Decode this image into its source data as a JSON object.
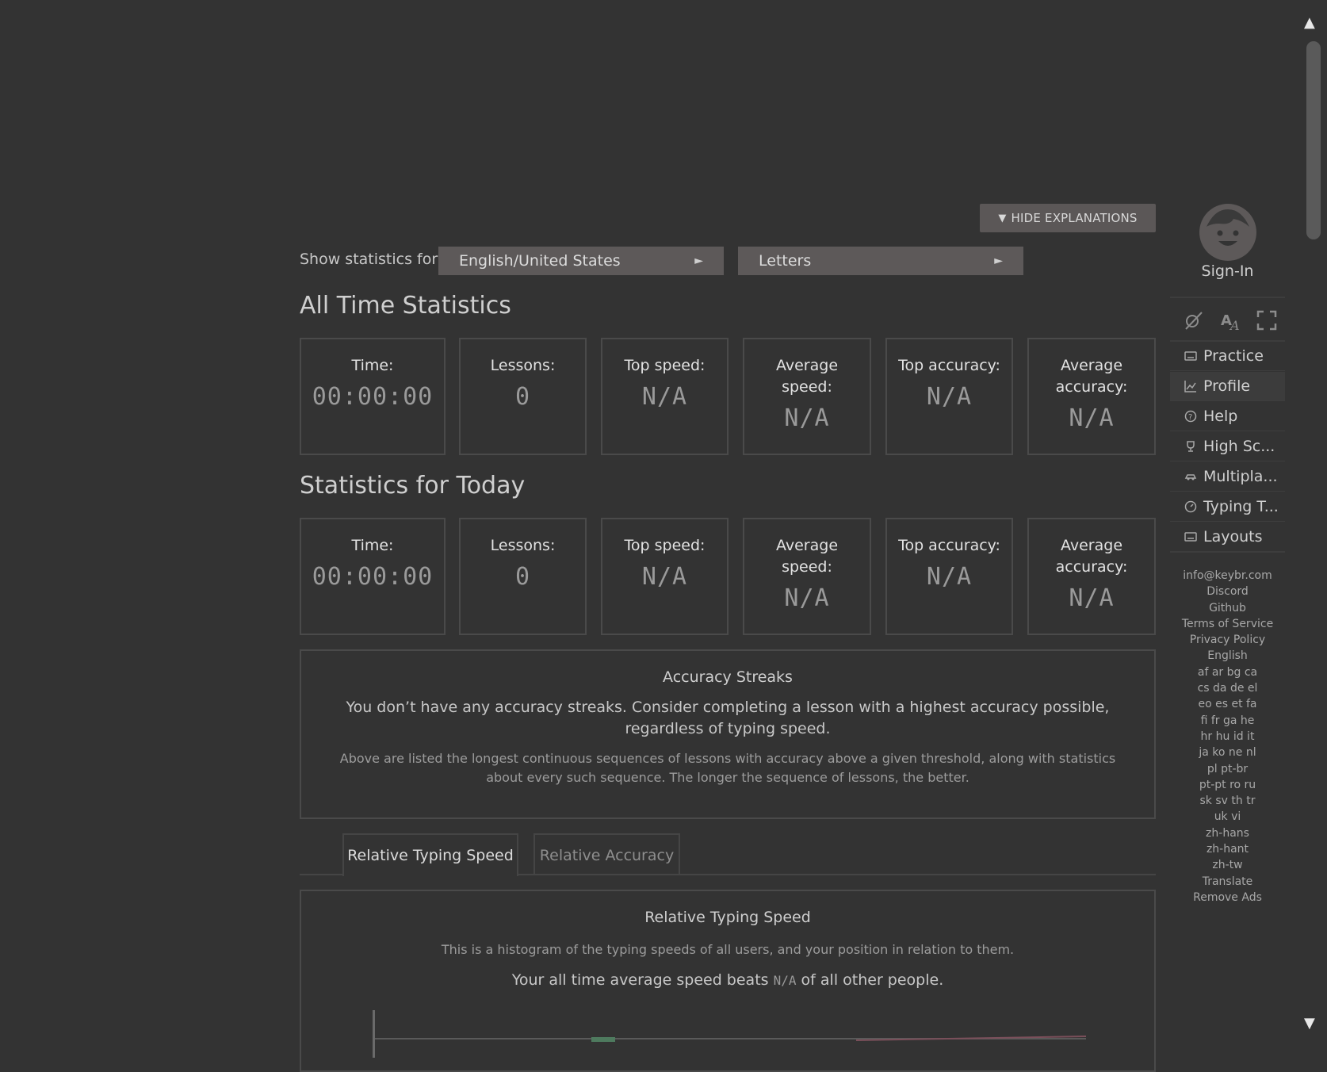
{
  "toolbar": {
    "hide_explanations": "HIDE EXPLANATIONS"
  },
  "filters": {
    "label": "Show statistics for:",
    "layout_value": "English/United States",
    "mode_value": "Letters"
  },
  "all_time": {
    "title": "All Time Statistics",
    "cards": [
      {
        "label": "Time:",
        "value": "00:00:00"
      },
      {
        "label": "Lessons:",
        "value": "0"
      },
      {
        "label": "Top speed:",
        "value": "N/A"
      },
      {
        "label": "Average speed:",
        "value": "N/A"
      },
      {
        "label": "Top accuracy:",
        "value": "N/A"
      },
      {
        "label": "Average accuracy:",
        "value": "N/A"
      }
    ]
  },
  "today": {
    "title": "Statistics for Today",
    "cards": [
      {
        "label": "Time:",
        "value": "00:00:00"
      },
      {
        "label": "Lessons:",
        "value": "0"
      },
      {
        "label": "Top speed:",
        "value": "N/A"
      },
      {
        "label": "Average speed:",
        "value": "N/A"
      },
      {
        "label": "Top accuracy:",
        "value": "N/A"
      },
      {
        "label": "Average accuracy:",
        "value": "N/A"
      }
    ]
  },
  "streaks": {
    "title": "Accuracy Streaks",
    "message": "You don’t have any accuracy streaks. Consider completing a lesson with a highest accuracy possible, regardless of typing speed.",
    "explanation": "Above are listed the longest continuous sequences of lessons with accuracy above a given threshold, along with statistics about every such sequence. The longer the sequence of lessons, the better."
  },
  "tabs": [
    {
      "label": "Relative Typing Speed",
      "active": true
    },
    {
      "label": "Relative Accuracy",
      "active": false
    }
  ],
  "relative_speed": {
    "title": "Relative Typing Speed",
    "description": "This is a histogram of the typing speeds of all users, and your position in relation to them.",
    "beats_prefix": "Your all time average speed beats",
    "beats_value": "N/A",
    "beats_suffix": "of all other people."
  },
  "sidebar": {
    "sign_in": "Sign-In",
    "nav": [
      {
        "label": "Practice",
        "icon": "keyboard-icon"
      },
      {
        "label": "Profile",
        "icon": "chart-icon",
        "active": true
      },
      {
        "label": "Help",
        "icon": "help-icon"
      },
      {
        "label": "High Sc...",
        "icon": "trophy-icon"
      },
      {
        "label": "Multipla...",
        "icon": "car-icon"
      },
      {
        "label": "Typing T...",
        "icon": "speedometer-icon"
      },
      {
        "label": "Layouts",
        "icon": "keyboard-icon"
      }
    ],
    "links": [
      "info@keybr.com",
      "Discord",
      "Github",
      "Terms of Service",
      "Privacy Policy",
      "English",
      "af ar bg ca",
      "cs da de el",
      "eo es et fa",
      "fi fr ga he",
      "hr hu id it",
      "ja ko ne nl",
      "pl pt-br",
      "pt-pt ro ru",
      "sk sv th tr",
      "uk vi",
      "zh-hans",
      "zh-hant",
      "zh-tw",
      "Translate",
      "Remove Ads"
    ]
  }
}
